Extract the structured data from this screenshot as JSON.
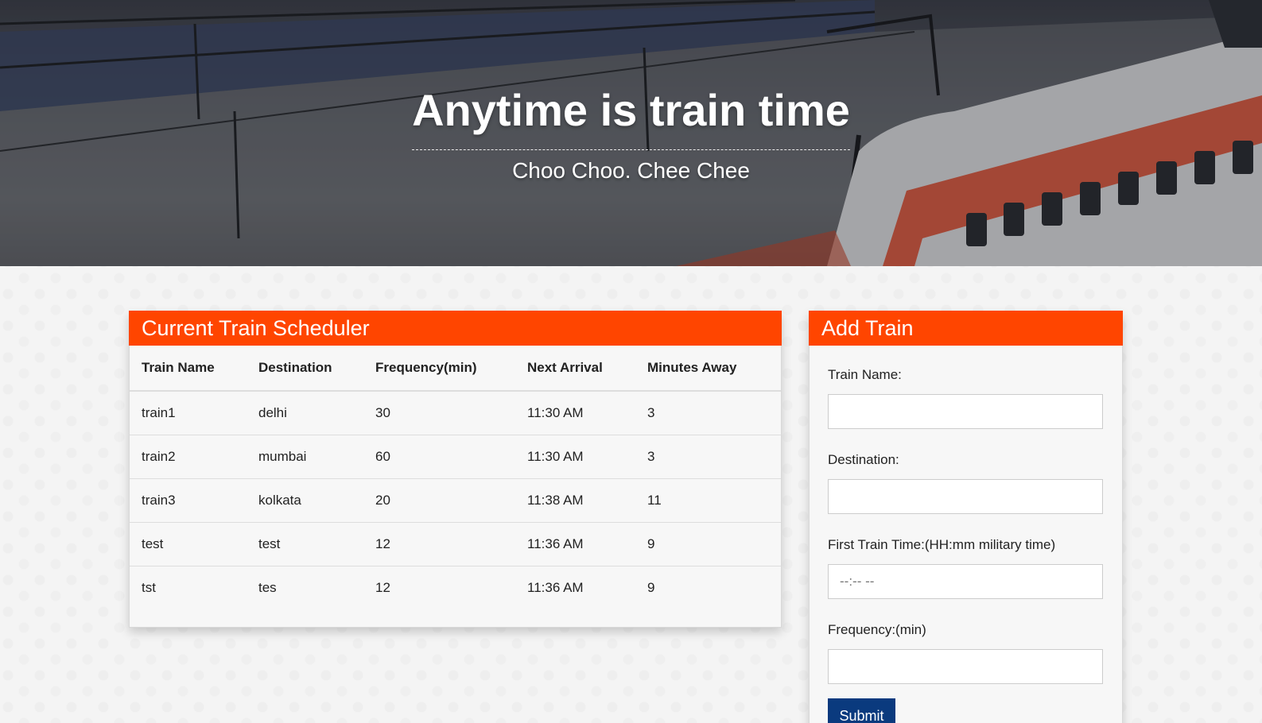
{
  "hero": {
    "title": "Anytime is train time",
    "subtitle": "Choo Choo. Chee Chee"
  },
  "schedule": {
    "title": "Current Train Scheduler",
    "columns": [
      "Train Name",
      "Destination",
      "Frequency(min)",
      "Next Arrival",
      "Minutes Away"
    ],
    "rows": [
      [
        "train1",
        "delhi",
        "30",
        "11:30 AM",
        "3"
      ],
      [
        "train2",
        "mumbai",
        "60",
        "11:30 AM",
        "3"
      ],
      [
        "train3",
        "kolkata",
        "20",
        "11:38 AM",
        "11"
      ],
      [
        "test",
        "test",
        "12",
        "11:36 AM",
        "9"
      ],
      [
        "tst",
        "tes",
        "12",
        "11:36 AM",
        "9"
      ]
    ]
  },
  "add_train": {
    "title": "Add Train",
    "train_name_label": "Train Name:",
    "train_name_value": "",
    "destination_label": "Destination:",
    "destination_value": "",
    "first_time_label": "First Train Time:(HH:mm military time)",
    "first_time_placeholder": "--:-- --",
    "frequency_label": "Frequency:(min)",
    "frequency_value": "",
    "submit_label": "Submit"
  },
  "colors": {
    "accent": "#ff4500",
    "button": "#0a3a7e"
  }
}
